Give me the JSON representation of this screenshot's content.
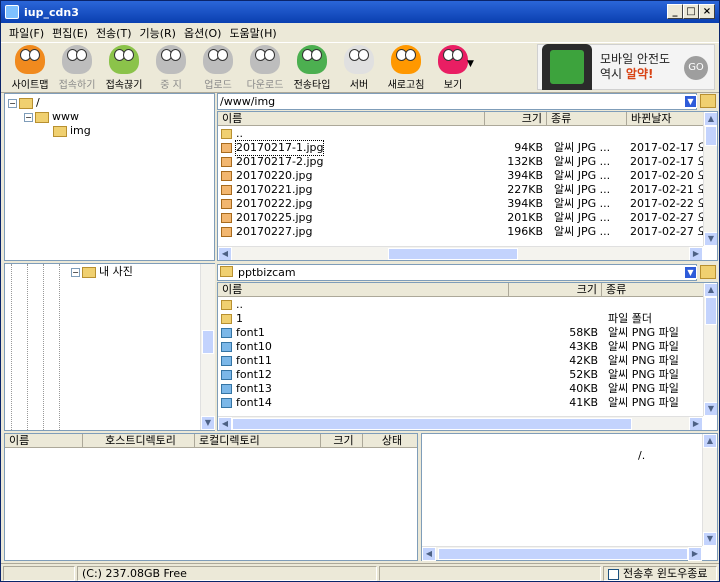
{
  "window": {
    "title": "iup_cdn3"
  },
  "menu": [
    "파일(F)",
    "편집(E)",
    "전송(T)",
    "기능(R)",
    "옵션(O)",
    "도움말(H)"
  ],
  "toolbar": [
    {
      "label": "사이트맵",
      "enabled": true,
      "color": "#f08a1e",
      "icon": "sitemap-icon"
    },
    {
      "label": "접속하기",
      "enabled": false,
      "color": "#bdbdbd",
      "icon": "connect-icon"
    },
    {
      "label": "접속끊기",
      "enabled": true,
      "color": "#8bc34a",
      "icon": "disconnect-icon"
    },
    {
      "label": "중 지",
      "enabled": false,
      "color": "#bdbdbd",
      "icon": "stop-icon"
    },
    {
      "label": "업로드",
      "enabled": false,
      "color": "#bdbdbd",
      "icon": "upload-icon"
    },
    {
      "label": "다운로드",
      "enabled": false,
      "color": "#bdbdbd",
      "icon": "download-icon"
    },
    {
      "label": "전송타입",
      "enabled": true,
      "color": "#4caf50",
      "icon": "transfer-type-icon"
    },
    {
      "label": "서버",
      "enabled": true,
      "color": "#e0e0e0",
      "icon": "server-icon"
    },
    {
      "label": "새로고침",
      "enabled": true,
      "color": "#ff9800",
      "icon": "refresh-icon"
    },
    {
      "label": "보기",
      "enabled": true,
      "color": "#e91e63",
      "icon": "view-icon"
    }
  ],
  "ad": {
    "line1": "모바일 안전도",
    "line2_prefix": "역시 ",
    "line2_highlight": "알약!",
    "go": "GO",
    "stars": "★★★★★"
  },
  "remote_tree": {
    "root": "/",
    "child": "www",
    "leaf": "img"
  },
  "remote": {
    "path": "/www/img",
    "columns": [
      "이름",
      "크기",
      "종류",
      "바뀐날자"
    ],
    "up": "..",
    "files": [
      {
        "name": "20170217-1.jpg",
        "size": "94KB",
        "type": "알씨 JPG ...",
        "date": "2017-02-17 오..."
      },
      {
        "name": "20170217-2.jpg",
        "size": "132KB",
        "type": "알씨 JPG ...",
        "date": "2017-02-17 오..."
      },
      {
        "name": "20170220.jpg",
        "size": "394KB",
        "type": "알씨 JPG ...",
        "date": "2017-02-20 오..."
      },
      {
        "name": "20170221.jpg",
        "size": "227KB",
        "type": "알씨 JPG ...",
        "date": "2017-02-21 오..."
      },
      {
        "name": "20170222.jpg",
        "size": "394KB",
        "type": "알씨 JPG ...",
        "date": "2017-02-22 오..."
      },
      {
        "name": "20170225.jpg",
        "size": "201KB",
        "type": "알씨 JPG ...",
        "date": "2017-02-27 오..."
      },
      {
        "name": "20170227.jpg",
        "size": "196KB",
        "type": "알씨 JPG ...",
        "date": "2017-02-27 오..."
      }
    ]
  },
  "local_tree": {
    "node": "내 사진"
  },
  "local": {
    "path": "pptbizcam",
    "columns": [
      "이름",
      "크기",
      "종류"
    ],
    "up": "..",
    "folder": {
      "name": "1",
      "type": "파일 폴더"
    },
    "files": [
      {
        "name": "font1",
        "size": "58KB",
        "type": "알씨 PNG 파일"
      },
      {
        "name": "font10",
        "size": "43KB",
        "type": "알씨 PNG 파일"
      },
      {
        "name": "font11",
        "size": "42KB",
        "type": "알씨 PNG 파일"
      },
      {
        "name": "font12",
        "size": "52KB",
        "type": "알씨 PNG 파일"
      },
      {
        "name": "font13",
        "size": "40KB",
        "type": "알씨 PNG 파일"
      },
      {
        "name": "font14",
        "size": "41KB",
        "type": "알씨 PNG 파일"
      }
    ]
  },
  "queue": {
    "columns": [
      "이름",
      "호스트디렉토리",
      "로컬디렉토리",
      "크기",
      "상태"
    ]
  },
  "log": {
    "text": "/."
  },
  "status": {
    "drive": "(C:)  237.08GB Free",
    "close_after": "전송후 윈도우종료"
  }
}
